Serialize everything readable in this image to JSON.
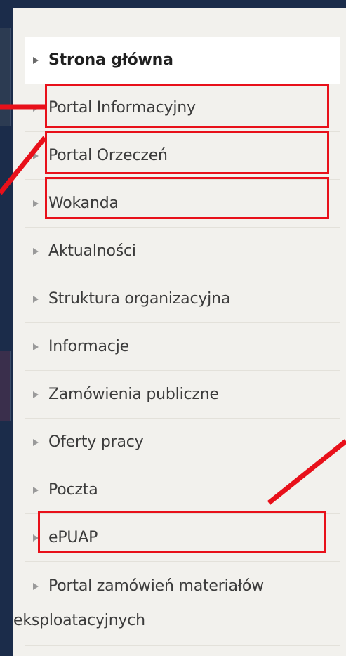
{
  "nav": {
    "items": [
      {
        "label": "Strona główna",
        "active": true
      },
      {
        "label": "Portal Informacyjny",
        "active": false
      },
      {
        "label": "Portal Orzeczeń",
        "active": false
      },
      {
        "label": "Wokanda",
        "active": false
      },
      {
        "label": "Aktualności",
        "active": false
      },
      {
        "label": "Struktura organizacyjna",
        "active": false
      },
      {
        "label": "Informacje",
        "active": false
      },
      {
        "label": "Zamówienia publiczne",
        "active": false
      },
      {
        "label": "Oferty pracy",
        "active": false
      },
      {
        "label": "Poczta",
        "active": false
      },
      {
        "label": "ePUAP",
        "active": false
      },
      {
        "label_line1": "Portal zamówień materiałów",
        "label_line2": "eksploatacyjnych",
        "active": false
      }
    ]
  },
  "colors": {
    "frame": "#1b2c4a",
    "panel": "#f2f1ed",
    "highlight": "#e8101a",
    "text": "#3b3b3b"
  }
}
